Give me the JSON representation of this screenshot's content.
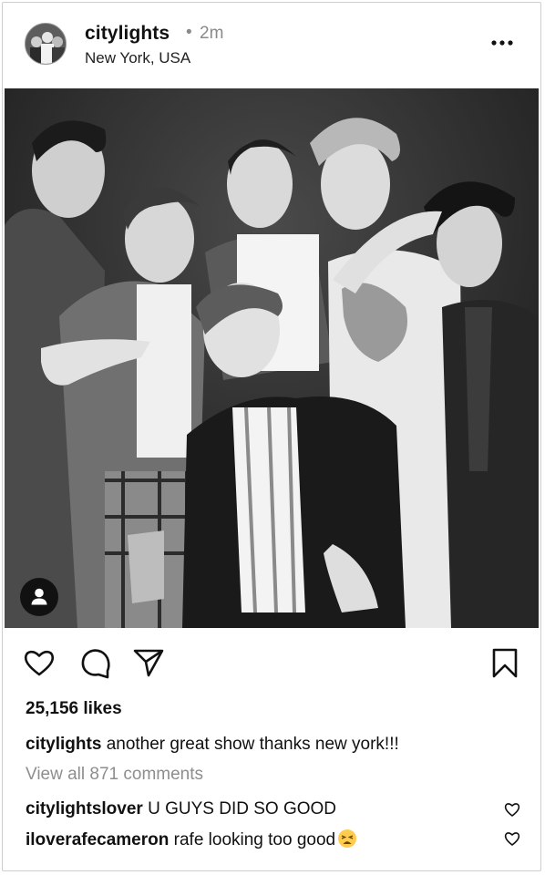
{
  "post": {
    "username": "citylights",
    "separator": "•",
    "time": "2m",
    "location": "New York, USA",
    "likes": "25,156 likes",
    "caption": {
      "user": "citylights",
      "text": "another great show thanks new york!!!"
    },
    "view_all_comments": "View all 871 comments",
    "comments": [
      {
        "user": "citylightslover",
        "text": "U GUYS DID SO GOOD"
      },
      {
        "user": "iloverafecameron",
        "text": "rafe looking too good",
        "emoji": "tired-face-emoji"
      }
    ]
  },
  "icons": {
    "more": "more-options-icon",
    "like": "heart-icon",
    "comment": "speech-bubble-icon",
    "share": "paper-plane-icon",
    "save": "bookmark-icon",
    "tag": "person-tag-icon",
    "comment_like": "heart-outline-icon"
  },
  "photo": {
    "description_style": "black-and-white group photo",
    "color": "#2a2a2a"
  },
  "colors": {
    "text": "#111111",
    "muted": "#8e8e8e",
    "border": "#cfcfcf"
  }
}
